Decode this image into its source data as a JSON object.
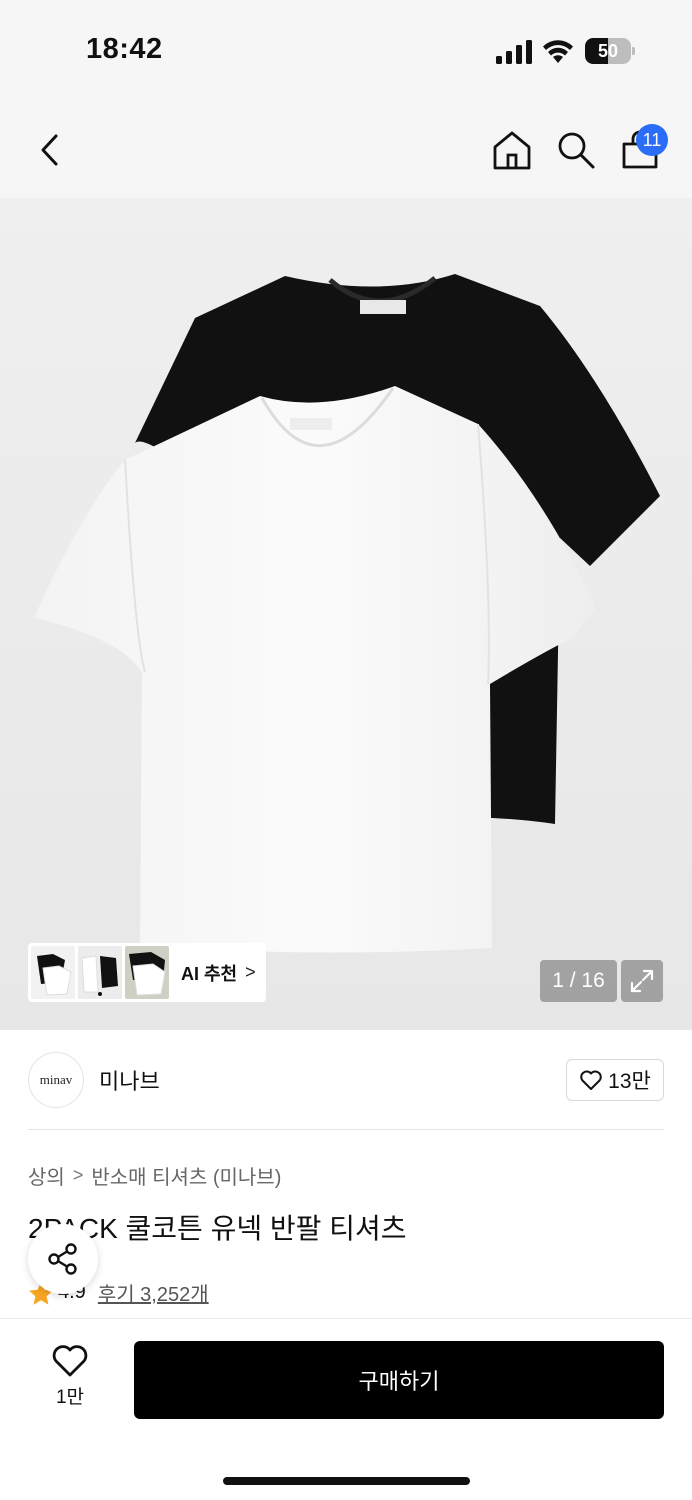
{
  "status_bar": {
    "time": "18:42",
    "battery_percent": "50",
    "battery_level": 0.5
  },
  "header": {
    "back_icon": "chevron-left-icon",
    "home_icon": "home-icon",
    "search_icon": "search-icon",
    "bag_icon": "shopping-bag-icon",
    "cart_badge": "11",
    "badge_color": "#2b6df6"
  },
  "gallery": {
    "page_counter": "1 / 16",
    "ai_recommend_label": "AI 추천",
    "ai_chevron": ">",
    "expand_icon": "expand-icon"
  },
  "brand": {
    "logo_text": "minav",
    "name": "미나브",
    "likes": "13만"
  },
  "breadcrumb": {
    "category": "상의",
    "separator": ">",
    "subcategory": "반소매 티셔츠 (미나브)"
  },
  "product": {
    "title": "2PACK 쿨코튼 유넥 반팔 티셔츠",
    "rating": "4.9",
    "reviews": "후기 3,252개"
  },
  "bottom_bar": {
    "wishlist_count": "1만",
    "buy_label": "구매하기",
    "buy_color": "#000000"
  }
}
